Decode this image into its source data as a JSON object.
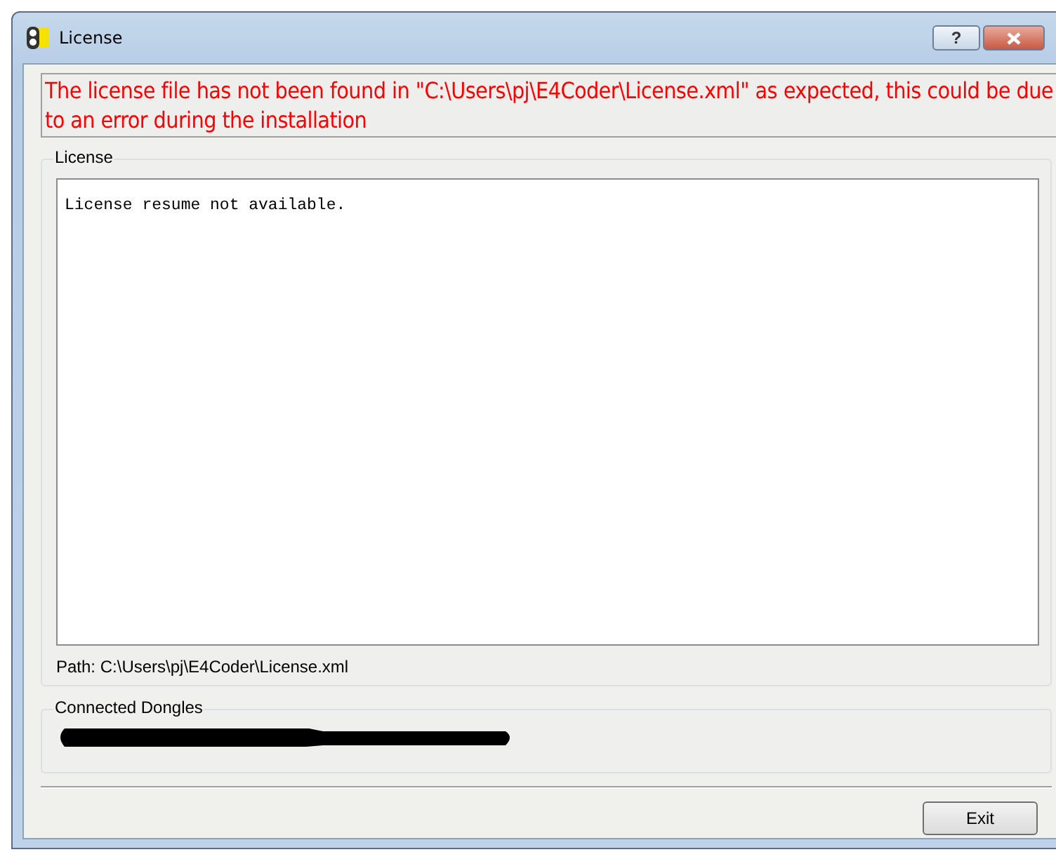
{
  "window": {
    "title": "License",
    "buttons": [
      {
        "kind": "help",
        "label": "?"
      },
      {
        "kind": "close"
      }
    ]
  },
  "error_message": "The license file has not been found in \"C:\\Users\\pj\\E4Coder\\License.xml\" as expected, this could be due to an error during the installation",
  "license_group": {
    "title": "License",
    "text": "License resume not available.",
    "path": "Path: C:\\Users\\pj\\E4Coder\\License.xml"
  },
  "dongles_group": {
    "title": "Connected Dongles",
    "redacted": true
  },
  "buttons": [
    "Exit"
  ]
}
